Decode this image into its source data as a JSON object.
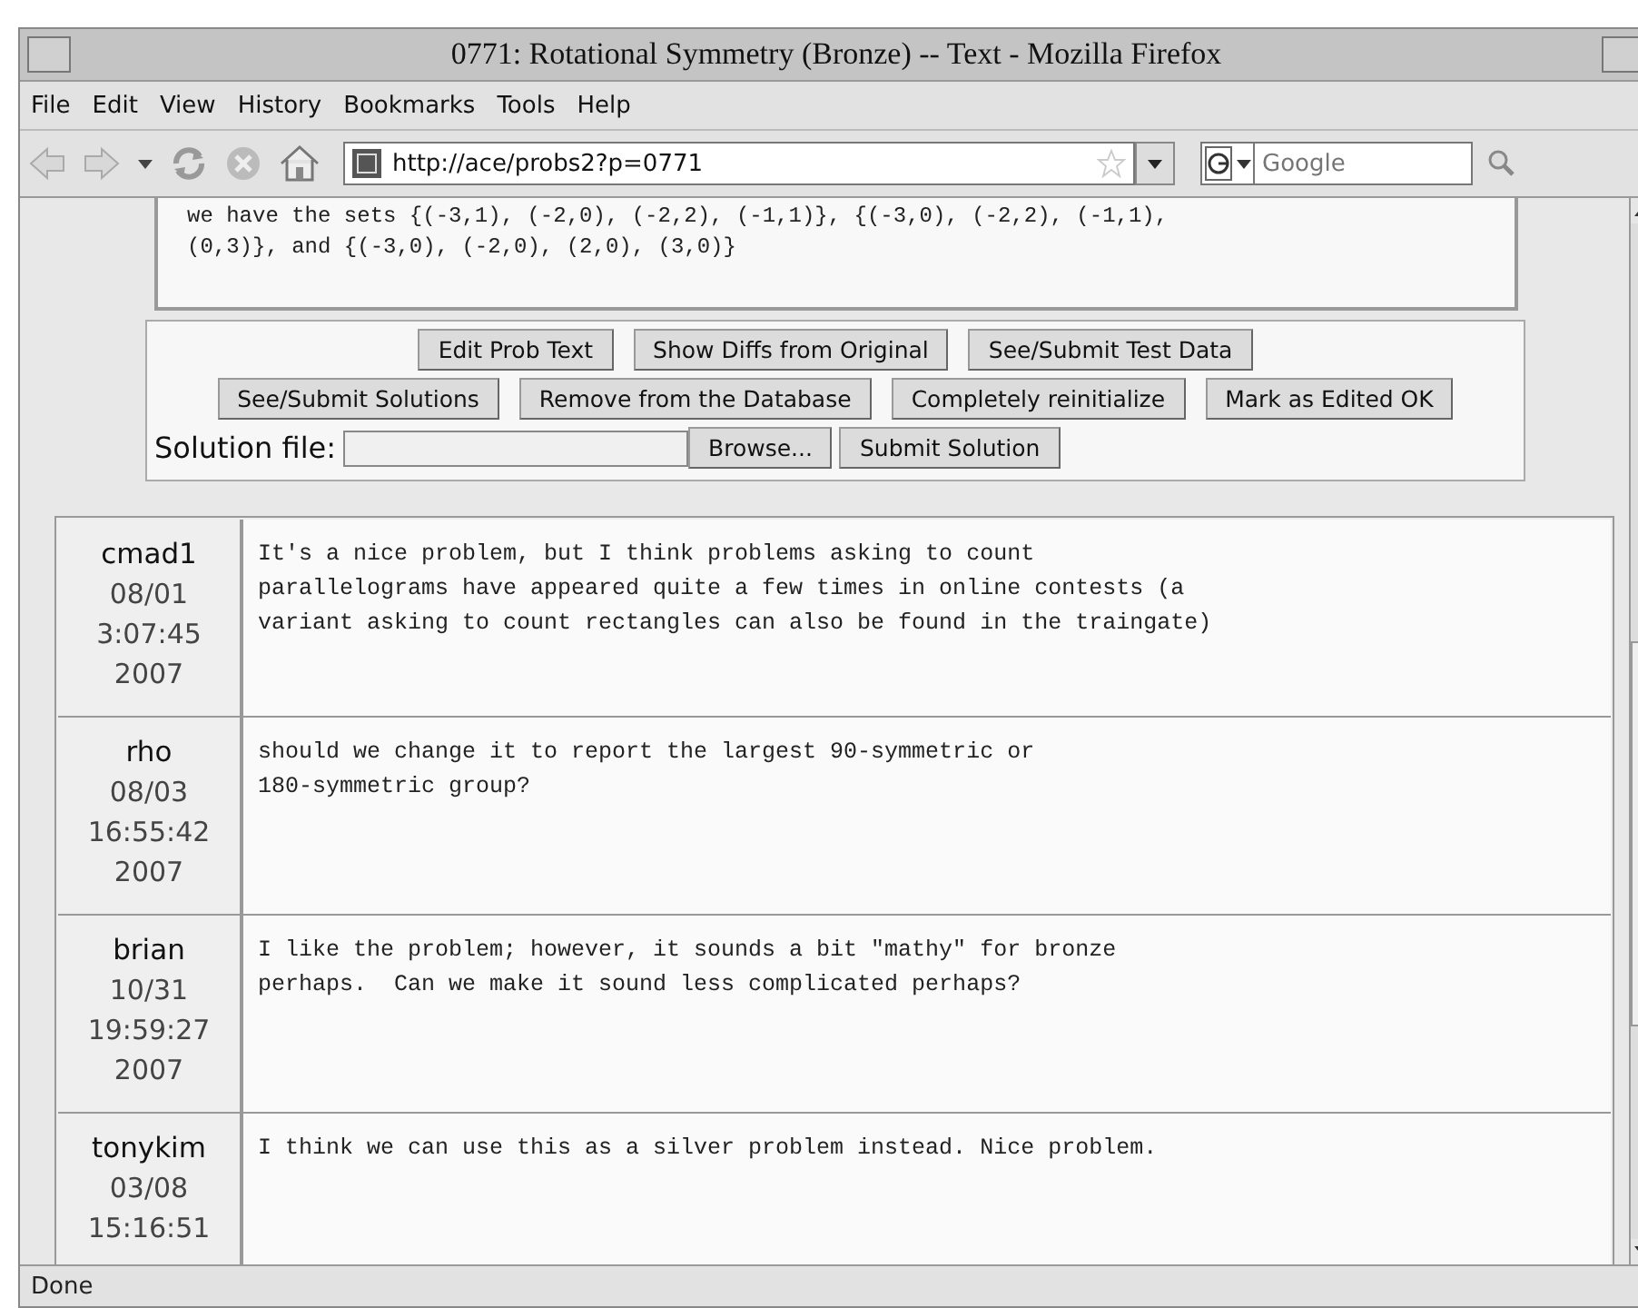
{
  "window": {
    "title": "0771: Rotational Symmetry (Bronze) -- Text - Mozilla Firefox"
  },
  "menu": [
    {
      "label": "File"
    },
    {
      "label": "Edit"
    },
    {
      "label": "View"
    },
    {
      "label": "History"
    },
    {
      "label": "Bookmarks"
    },
    {
      "label": "Tools"
    },
    {
      "label": "Help"
    }
  ],
  "address": {
    "value": "http://ace/probs2?p=0771"
  },
  "search": {
    "placeholder": "Google"
  },
  "problem_text": [
    "we have the sets {(-3,1), (-2,0), (-2,2), (-1,1)}, {(-3,0), (-2,2), (-1,1),",
    "(0,3)}, and {(-3,0), (-2,0), (2,0), (3,0)}"
  ],
  "button_rows": [
    [
      "Edit Prob Text",
      "Show Diffs from Original",
      "See/Submit Test Data"
    ],
    [
      "See/Submit Solutions",
      "Remove from the Database",
      "Completely reinitialize",
      "Mark as Edited OK"
    ]
  ],
  "solution": {
    "label": "Solution file:",
    "browse": "Browse...",
    "submit": "Submit Solution"
  },
  "comments": [
    {
      "author": "cmad1",
      "meta": [
        "08/01",
        "3:07:45",
        "2007"
      ],
      "text": "It's a nice problem, but I think problems asking to count\nparallelograms have appeared quite a few times in online contests (a\nvariant asking to count rectangles can also be found in the traingate)"
    },
    {
      "author": "rho",
      "meta": [
        "08/03",
        "16:55:42",
        "2007"
      ],
      "text": "should we change it to report the largest 90-symmetric or\n180-symmetric group?"
    },
    {
      "author": "brian",
      "meta": [
        "10/31",
        "19:59:27",
        "2007"
      ],
      "text": "I like the problem; however, it sounds a bit \"mathy\" for bronze\nperhaps.  Can we make it sound less complicated perhaps?"
    },
    {
      "author": "tonykim",
      "meta": [
        "03/08",
        "15:16:51"
      ],
      "text": "I think we can use this as a silver problem instead. Nice problem."
    }
  ],
  "status_bar": "Done"
}
